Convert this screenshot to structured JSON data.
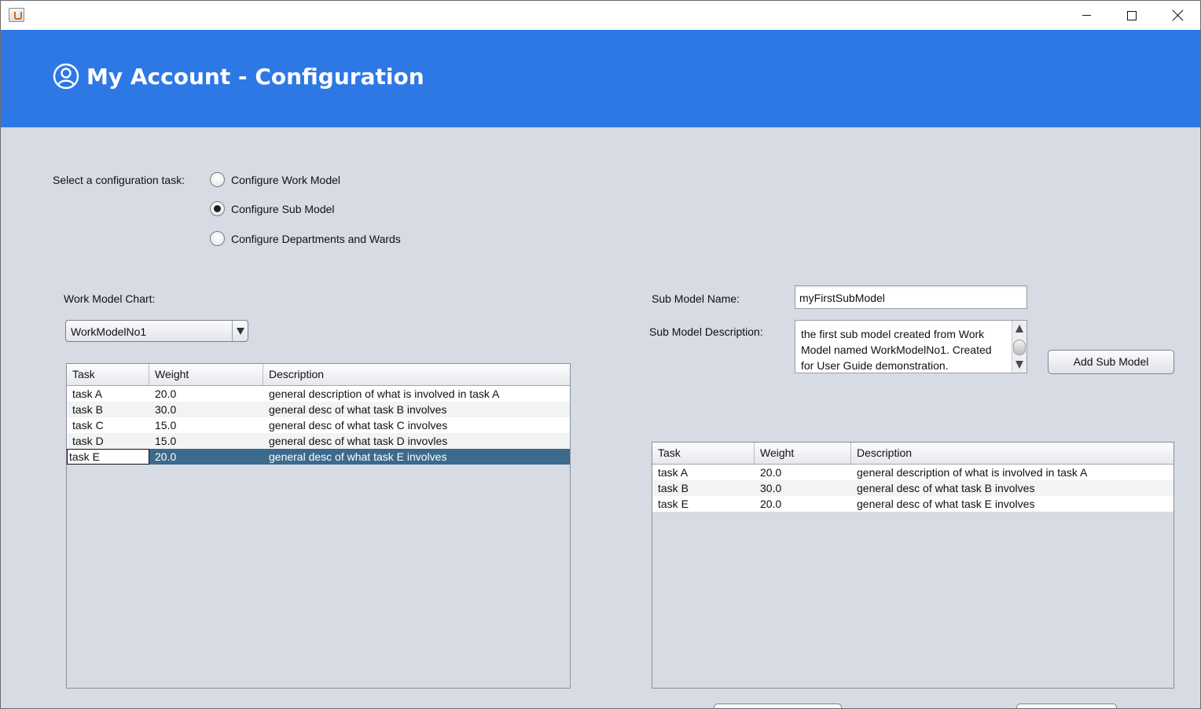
{
  "window": {
    "title": "",
    "controls": {
      "minimize": "minimize-icon",
      "maximize": "maximize-icon",
      "close": "close-icon"
    }
  },
  "header": {
    "title": "My Account - Configuration",
    "icon": "user-circle-icon",
    "background": "#2e78e6"
  },
  "config_task": {
    "label": "Select a configuration task:",
    "options": [
      {
        "label": "Configure Work Model",
        "selected": false
      },
      {
        "label": "Configure Sub Model",
        "selected": true
      },
      {
        "label": "Configure Departments and Wards",
        "selected": false
      }
    ]
  },
  "work_model": {
    "label": "Work Model Chart:",
    "selected": "WorkModelNo1"
  },
  "left_table": {
    "columns": [
      "Task",
      "Weight",
      "Description"
    ],
    "rows": [
      [
        "task A",
        "20.0",
        "general description of what is involved in task A"
      ],
      [
        "task B",
        "30.0",
        "general desc of what task B involves"
      ],
      [
        "task C",
        "15.0",
        "general desc of what task C involves"
      ],
      [
        "task D",
        "15.0",
        "general desc of what task D invovles"
      ],
      [
        "task E",
        "20.0",
        "general desc of what task E involves"
      ]
    ],
    "selected_row": 4
  },
  "sub_model": {
    "name_label": "Sub Model Name:",
    "name_value": "myFirstSubModel",
    "description_label": "Sub Model Description:",
    "description_value": "the first sub model created from Work Model named WorkModelNo1. Created for User Guide demonstration.",
    "add_button": "Add Sub Model"
  },
  "right_table": {
    "columns": [
      "Task",
      "Weight",
      "Description"
    ],
    "rows": [
      [
        "task A",
        "20.0",
        "general description of what is involved in task A"
      ],
      [
        "task B",
        "30.0",
        "general desc of what task B involves"
      ],
      [
        "task E",
        "20.0",
        "general desc of what task E involves"
      ]
    ]
  },
  "colors": {
    "header": "#2e78e6",
    "background": "#d7dbe3",
    "selection": "#3b6a8c"
  }
}
